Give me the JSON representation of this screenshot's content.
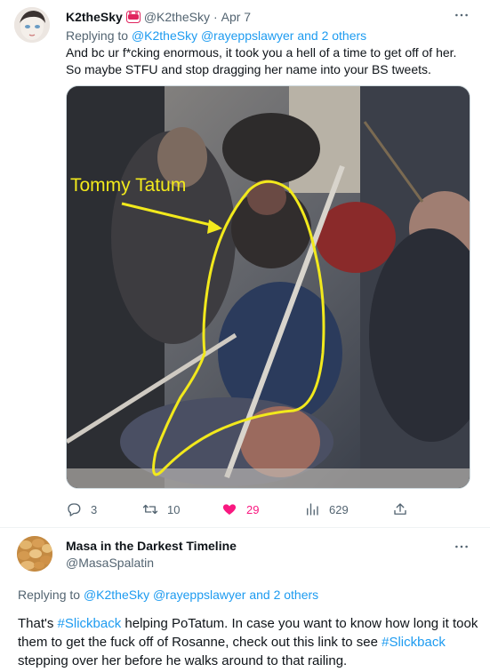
{
  "tweet1": {
    "name": "K2theSky",
    "handle": "@K2theSky",
    "separator": "·",
    "date": "Apr 7",
    "replying_prefix": "Replying to ",
    "replying_mentions": "@K2theSky @rayeppslawyer",
    "replying_and": " and ",
    "replying_others": "2 others",
    "text": "And bc ur f*cking enormous, it took you a hell of a time to get off of her. So maybe STFU and stop dragging her name into your BS tweets.",
    "image_caption": "Tommy Tatum",
    "actions": {
      "replies": "3",
      "retweets": "10",
      "likes": "29",
      "views": "629"
    },
    "icons": {
      "more": "more-icon",
      "badge": "red-badge-icon",
      "reply": "reply-icon",
      "retweet": "retweet-icon",
      "like": "heart-filled-icon",
      "views": "views-icon",
      "share": "share-icon"
    },
    "colors": {
      "accent": "#1d9bf0",
      "like": "#f91880",
      "annotation": "#f2e91c",
      "muted": "#536471"
    }
  },
  "tweet2": {
    "name": "Masa in the Darkest Timeline",
    "handle": "@MasaSpalatin",
    "replying_prefix": "Replying to ",
    "replying_mentions": "@K2theSky @rayeppslawyer",
    "replying_and": " and ",
    "replying_others": "2 others",
    "text_1": "That's ",
    "hashtag_1": "#Slickback",
    "text_2": " helping PoTatum. In case you want to know how long it took them to get the fuck off of Rosanne, check out this link to see ",
    "hashtag_2": "#Slickback",
    "text_3": " stepping over her before he walks around to that railing."
  }
}
